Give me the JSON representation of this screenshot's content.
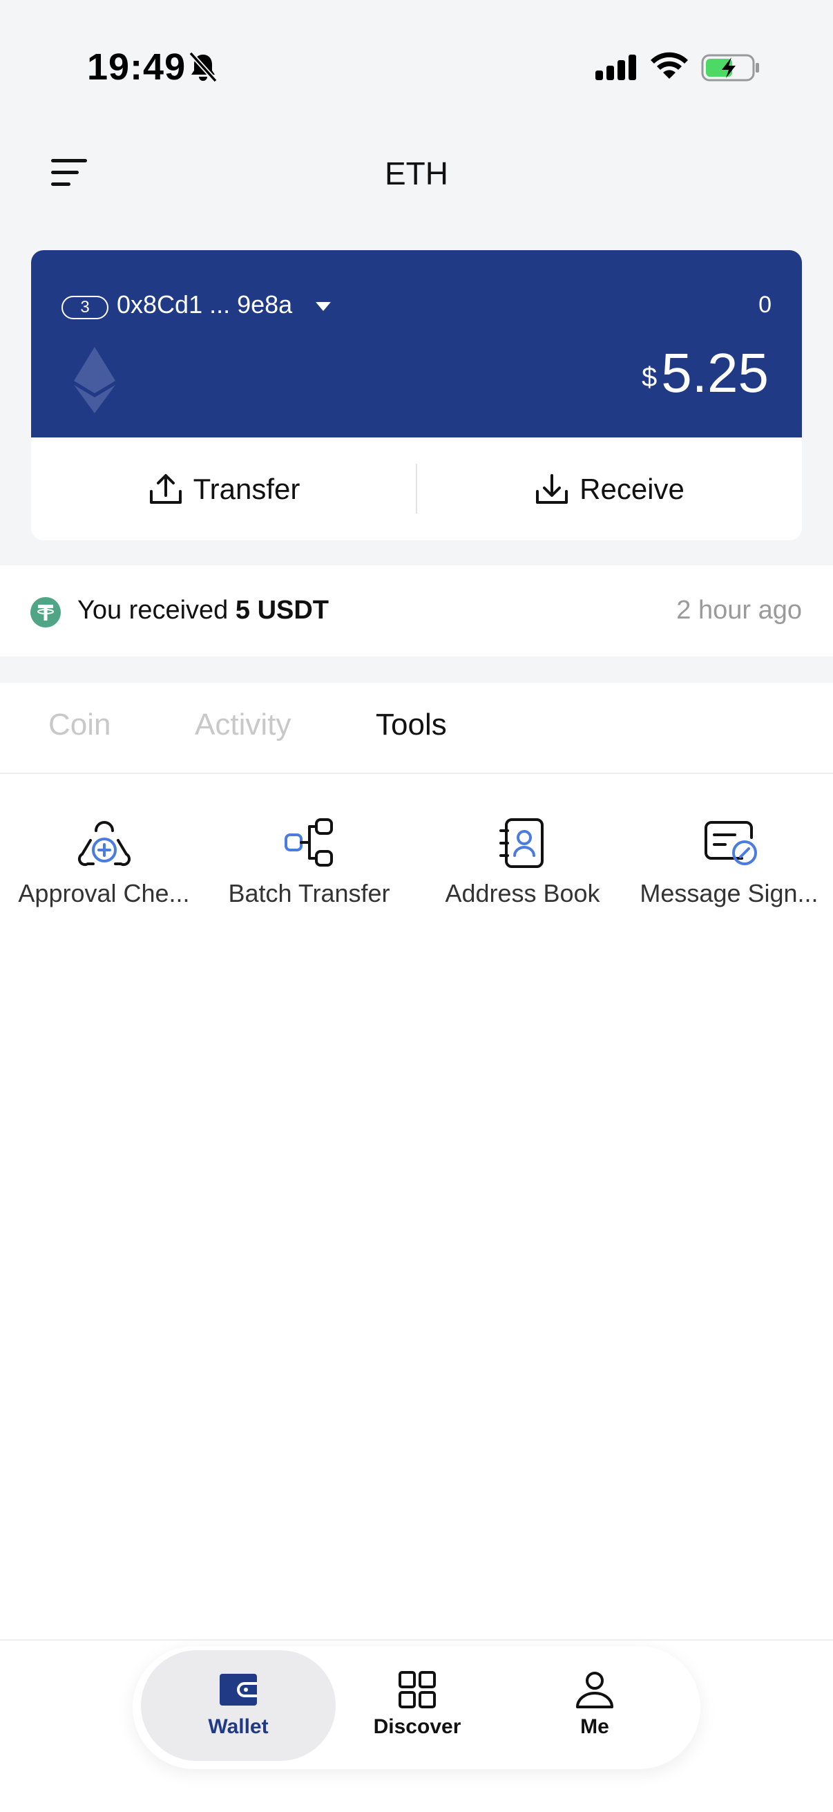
{
  "status_bar": {
    "time": "19:49",
    "icons": [
      "bell-off-icon",
      "signal-icon",
      "wifi-icon",
      "battery-charging-icon"
    ]
  },
  "header": {
    "title": "ETH",
    "menu_icon": "menu-icon"
  },
  "wallet_card": {
    "account_index": "3",
    "address": "0x8Cd1 ... 9e8a",
    "count": "0",
    "currency_symbol": "$",
    "balance": "5.25",
    "chain_icon": "ethereum-logo",
    "actions": {
      "transfer_label": "Transfer",
      "receive_label": "Receive"
    }
  },
  "notification": {
    "icon": "tether-icon",
    "prefix": "You received ",
    "amount": "5 USDT",
    "time": "2 hour ago"
  },
  "tabs": [
    {
      "label": "Coin",
      "active": false
    },
    {
      "label": "Activity",
      "active": false
    },
    {
      "label": "Tools",
      "active": true
    }
  ],
  "tools": [
    {
      "label": "Approval Che...",
      "icon": "approval-check-icon"
    },
    {
      "label": "Batch Transfer",
      "icon": "batch-transfer-icon"
    },
    {
      "label": "Address Book",
      "icon": "address-book-icon"
    },
    {
      "label": "Message Sign...",
      "icon": "message-sign-icon"
    }
  ],
  "bottom_nav": [
    {
      "label": "Wallet",
      "icon": "wallet-icon",
      "active": true
    },
    {
      "label": "Discover",
      "icon": "grid-icon",
      "active": false
    },
    {
      "label": "Me",
      "icon": "person-icon",
      "active": false
    }
  ],
  "colors": {
    "card_blue": "#213a86",
    "accent_blue": "#4a7be0",
    "tether_green": "#50a586",
    "page_grey": "#f4f5f7"
  }
}
